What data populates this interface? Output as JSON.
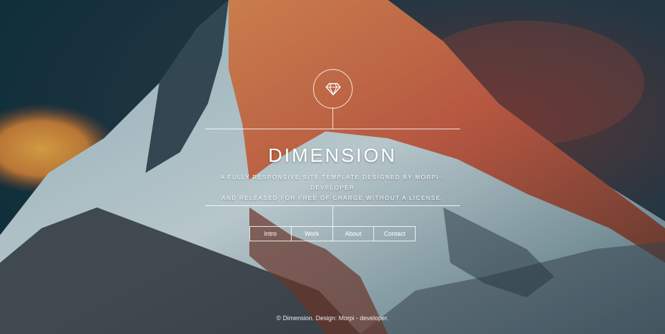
{
  "header": {
    "logo_icon": "diamond-icon",
    "title": "DIMENSION",
    "subtitle_line1": "A fully responsive site template designed by Morpi - developer",
    "subtitle_line2": "and released for free of charge without a license."
  },
  "nav": {
    "items": [
      {
        "label": "Intro"
      },
      {
        "label": "Work"
      },
      {
        "label": "About"
      },
      {
        "label": "Contact"
      }
    ]
  },
  "footer": {
    "copyright": "© Dimension. Design: Morpi - developer."
  },
  "colors": {
    "sky": "#1b3a45",
    "sunlit_rock": "#d9643a",
    "snow": "#cfe3ea"
  }
}
